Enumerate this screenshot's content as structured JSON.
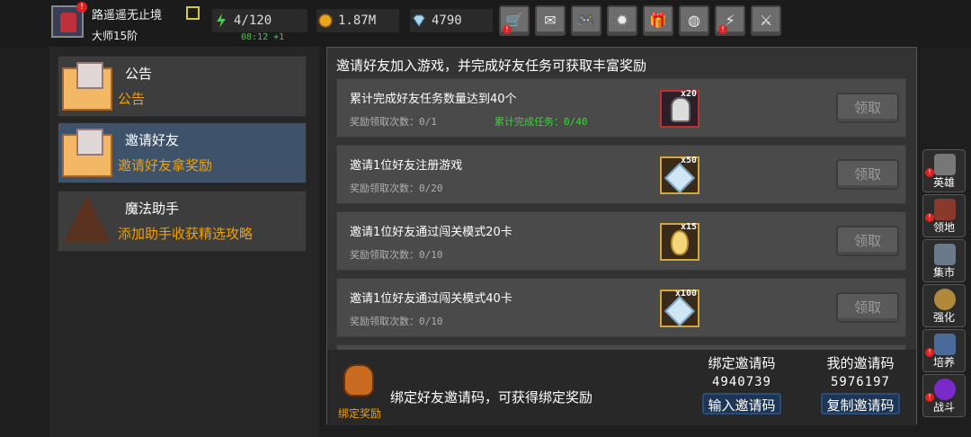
{
  "player": {
    "name": "路遥遥无止境",
    "rank": "大师15阶"
  },
  "resources": {
    "energy": "4/120",
    "energy_timer": "08:12 +1",
    "gold": "1.87M",
    "gems": "4790"
  },
  "toolbar_icons": [
    "shop-cart-icon",
    "mail-icon",
    "gamepad-icon",
    "settings-gear-icon",
    "gift-icon",
    "color-wheel-icon",
    "broken-sword-icon",
    "crossed-swords-icon"
  ],
  "sidebar": {
    "items": [
      {
        "title": "公告",
        "subtitle": "公告"
      },
      {
        "title": "邀请好友",
        "subtitle": "邀请好友拿奖励"
      },
      {
        "title": "魔法助手",
        "subtitle": "添加助手收获精选攻略"
      }
    ]
  },
  "main": {
    "title": "邀请好友加入游戏，并完成好友任务可获取丰富奖励",
    "tasks": [
      {
        "name": "累计完成好友任务数量达到40个",
        "count": "奖励领取次数：0/1",
        "progress": "累计完成任务：0/40",
        "qty": "x20",
        "claim": "领取"
      },
      {
        "name": "邀请1位好友注册游戏",
        "count": "奖励领取次数：0/20",
        "qty": "x50",
        "claim": "领取"
      },
      {
        "name": "邀请1位好友通过闯关模式20卡",
        "count": "奖励领取次数：0/10",
        "qty": "x15",
        "claim": "领取"
      },
      {
        "name": "邀请1位好友通过闯关模式40卡",
        "count": "奖励领取次数：0/10",
        "qty": "x100",
        "claim": "领取"
      }
    ],
    "footer": {
      "bag_label": "绑定奖励",
      "bind_text": "绑定好友邀请码，可获得绑定奖励",
      "bind_code_label": "绑定邀请码",
      "bind_code": "4940739",
      "bind_button": "输入邀请码",
      "my_code_label": "我的邀请码",
      "my_code": "5976197",
      "copy_button": "复制邀请码"
    }
  },
  "right_nav": [
    {
      "label": "英雄",
      "alert": true
    },
    {
      "label": "领地",
      "alert": true
    },
    {
      "label": "集市",
      "alert": false
    },
    {
      "label": "强化",
      "alert": false
    },
    {
      "label": "培养",
      "alert": true
    },
    {
      "label": "战斗",
      "alert": true
    }
  ],
  "colors": {
    "accent_orange": "#f3a000",
    "progress_green": "#3dd13d",
    "active_tab": "#3e526a"
  }
}
